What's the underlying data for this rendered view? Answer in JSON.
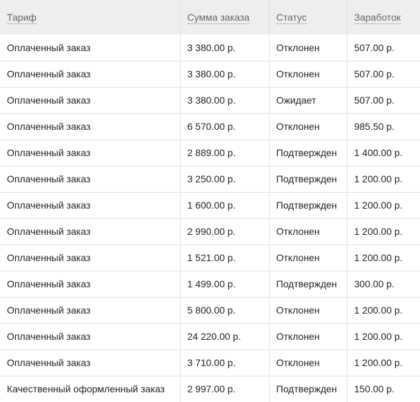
{
  "table": {
    "headers": [
      "Тариф",
      "Сумма заказа",
      "Статус",
      "Заработок"
    ],
    "rows": [
      [
        "Оплаченный заказ",
        "3 380.00 р.",
        "Отклонен",
        "507.00 р."
      ],
      [
        "Оплаченный заказ",
        "3 380.00 р.",
        "Отклонен",
        "507.00 р."
      ],
      [
        "Оплаченный заказ",
        "3 380.00 р.",
        "Ожидает",
        "507.00 р."
      ],
      [
        "Оплаченный заказ",
        "6 570.00 р.",
        "Отклонен",
        "985.50 р."
      ],
      [
        "Оплаченный заказ",
        "2 889.00 р.",
        "Подтвержден",
        "1 400.00 р."
      ],
      [
        "Оплаченный заказ",
        "3 250.00 р.",
        "Подтвержден",
        "1 200.00 р."
      ],
      [
        "Оплаченный заказ",
        "1 600.00 р.",
        "Подтвержден",
        "1 200.00 р."
      ],
      [
        "Оплаченный заказ",
        "2 990.00 р.",
        "Отклонен",
        "1 200.00 р."
      ],
      [
        "Оплаченный заказ",
        "1 521.00 р.",
        "Отклонен",
        "1 200.00 р."
      ],
      [
        "Оплаченный заказ",
        "1 499.00 р.",
        "Подтвержден",
        "300.00 р."
      ],
      [
        "Оплаченный заказ",
        "5 800.00 р.",
        "Отклонен",
        "1 200.00 р."
      ],
      [
        "Оплаченный заказ",
        "24 220.00 р.",
        "Отклонен",
        "1 200.00 р."
      ],
      [
        "Оплаченный заказ",
        "3 710.00 р.",
        "Отклонен",
        "1 200.00 р."
      ],
      [
        "Качественный оформленный заказ",
        "2 997.00 р.",
        "Подтвержден",
        "150.00 р."
      ]
    ]
  }
}
